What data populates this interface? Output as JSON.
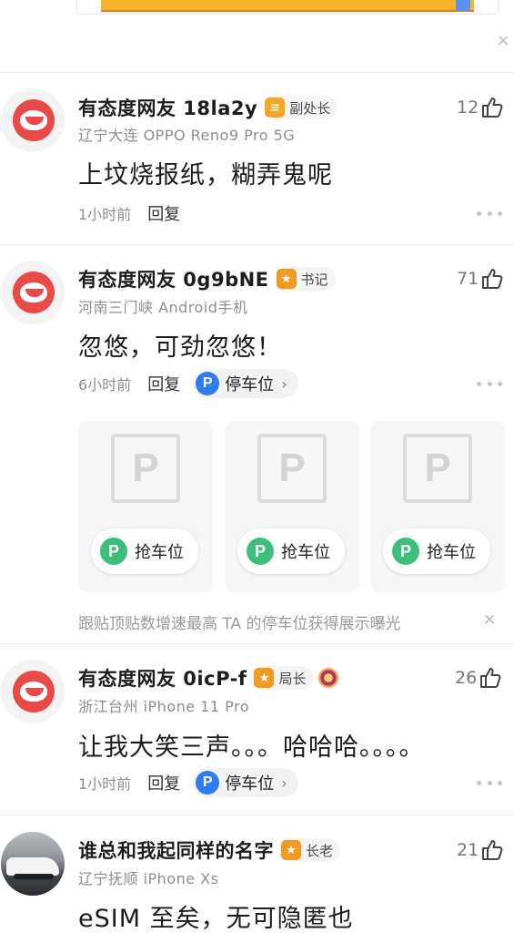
{
  "banner": {
    "close_icon": "close-icon"
  },
  "comments": [
    {
      "username": "有态度网友 18la2y",
      "badge_icon": "shield-rank-icon",
      "badge": "副处长",
      "meta": "辽宁大连   OPPO Reno9 Pro 5G",
      "text": "上坟烧报纸，糊弄鬼呢",
      "time": "1小时前",
      "reply": "回复",
      "likes": "12"
    },
    {
      "username": "有态度网友 0g9bNE",
      "badge_icon": "star-rank-icon",
      "badge": "书记",
      "meta": "河南三门峡   Android手机",
      "text": "忽悠，可劲忽悠！",
      "time": "6小时前",
      "reply": "回复",
      "parking_label": "停车位",
      "likes": "71"
    },
    {
      "username": "有态度网友 0icP-f",
      "badge_icon": "star-rank-icon",
      "badge": "局长",
      "meta": "浙江台州   iPhone 11 Pro",
      "text": "让我大笑三声。。。哈哈哈。。。。",
      "time": "1小时前",
      "reply": "回复",
      "parking_label": "停车位",
      "likes": "26"
    },
    {
      "username": "谁总和我起同样的名字",
      "badge_icon": "star-rank-icon",
      "badge": "长老",
      "meta": "辽宁抚顺   iPhone Xs",
      "text": "eSIM 至矣，无可隐匿也",
      "likes": "21"
    }
  ],
  "parking_cards": [
    {
      "label": "抢车位"
    },
    {
      "label": "抢车位"
    },
    {
      "label": "抢车位"
    }
  ],
  "promo": {
    "text": "跟贴顶贴数增速最高 TA 的停车位获得展示曝光"
  },
  "colors": {
    "accent": "#2f7cf2",
    "green": "#3dbf7c",
    "badge": "#f6a623",
    "avatar_red": "#e94a48"
  }
}
